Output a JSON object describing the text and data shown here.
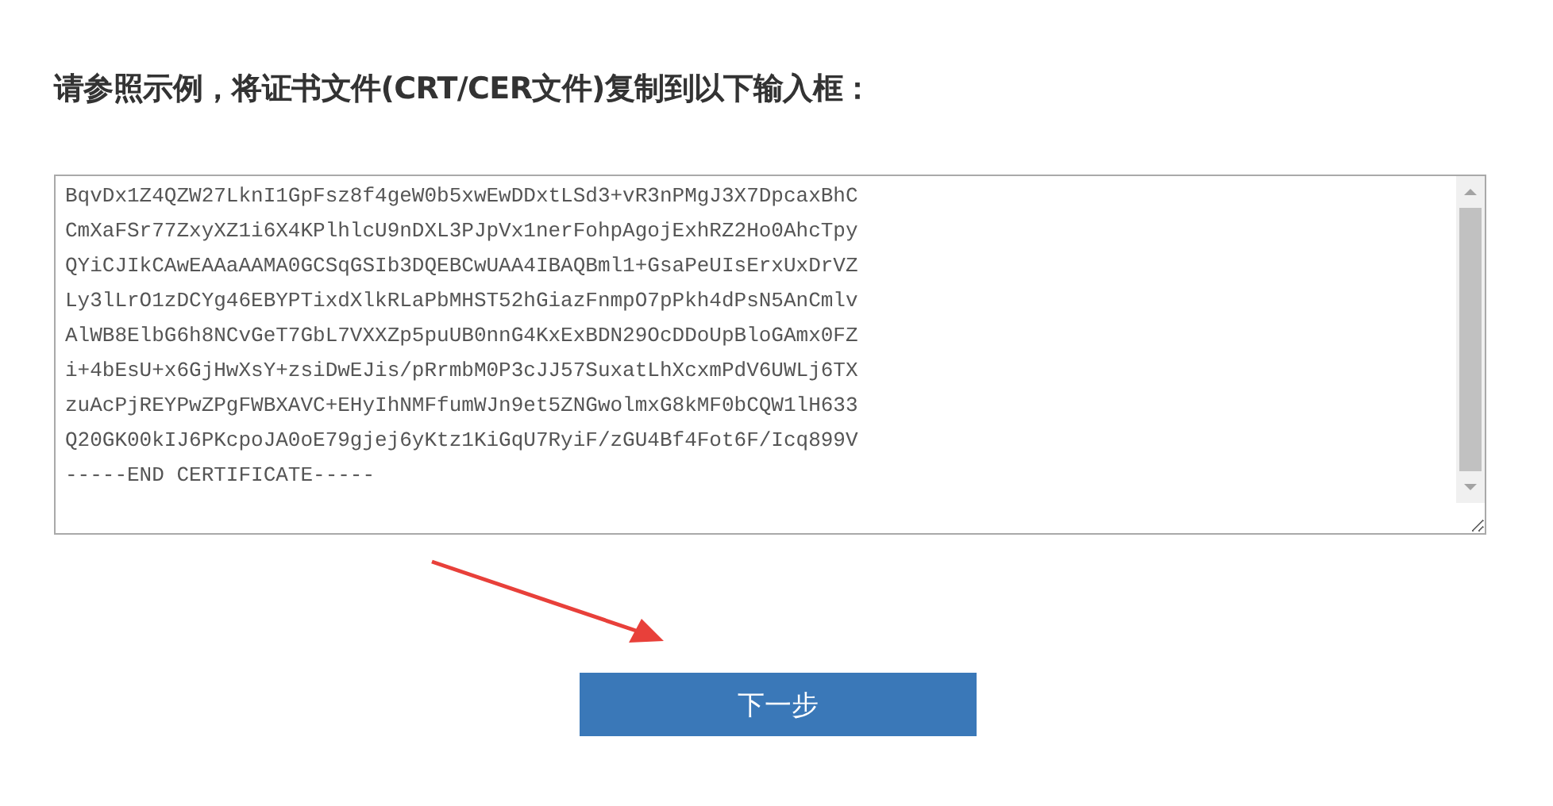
{
  "heading": "请参照示例，将证书文件(CRT/CER文件)复制到以下输入框：",
  "certificate_field": {
    "lines": [
      "BqvDx1Z4QZW27LknI1GpFsz8f4geW0b5xwEwDDxtLSd3+vR3nPMgJ3X7DpcaxBhC",
      "CmXaFSr77ZxyXZ1i6X4KPlhlcU9nDXL3PJpVx1nerFohpAgojExhRZ2Ho0AhcTpy",
      "QYiCJIkCAwEAAaAAMA0GCSqGSIb3DQEBCwUAA4IBAQBml1+GsaPeUIsErxUxDrVZ",
      "Ly3lLrO1zDCYg46EBYPTixdXlkRLaPbMHST52hGiazFnmpO7pPkh4dPsN5AnCmlv",
      "AlWB8ElbG6h8NCvGeT7GbL7VXXZp5puUB0nnG4KxExBDN29OcDDoUpBloGAmx0FZ",
      "i+4bEsU+x6GjHwXsY+zsiDwEJis/pRrmbM0P3cJJ57SuxatLhXcxmPdV6UWLj6TX",
      "zuAcPjREYPwZPgFWBXAVC+EHyIhNMFfumWJn9et5ZNGwolmxG8kMF0bCQW1lH633",
      "Q20GK00kIJ6PKcpoJA0oE79gjej6yKtz1KiGqU7RyiF/zGU4Bf4Fot6F/Icq899V",
      "-----END CERTIFICATE-----"
    ]
  },
  "next_button": "下一步"
}
